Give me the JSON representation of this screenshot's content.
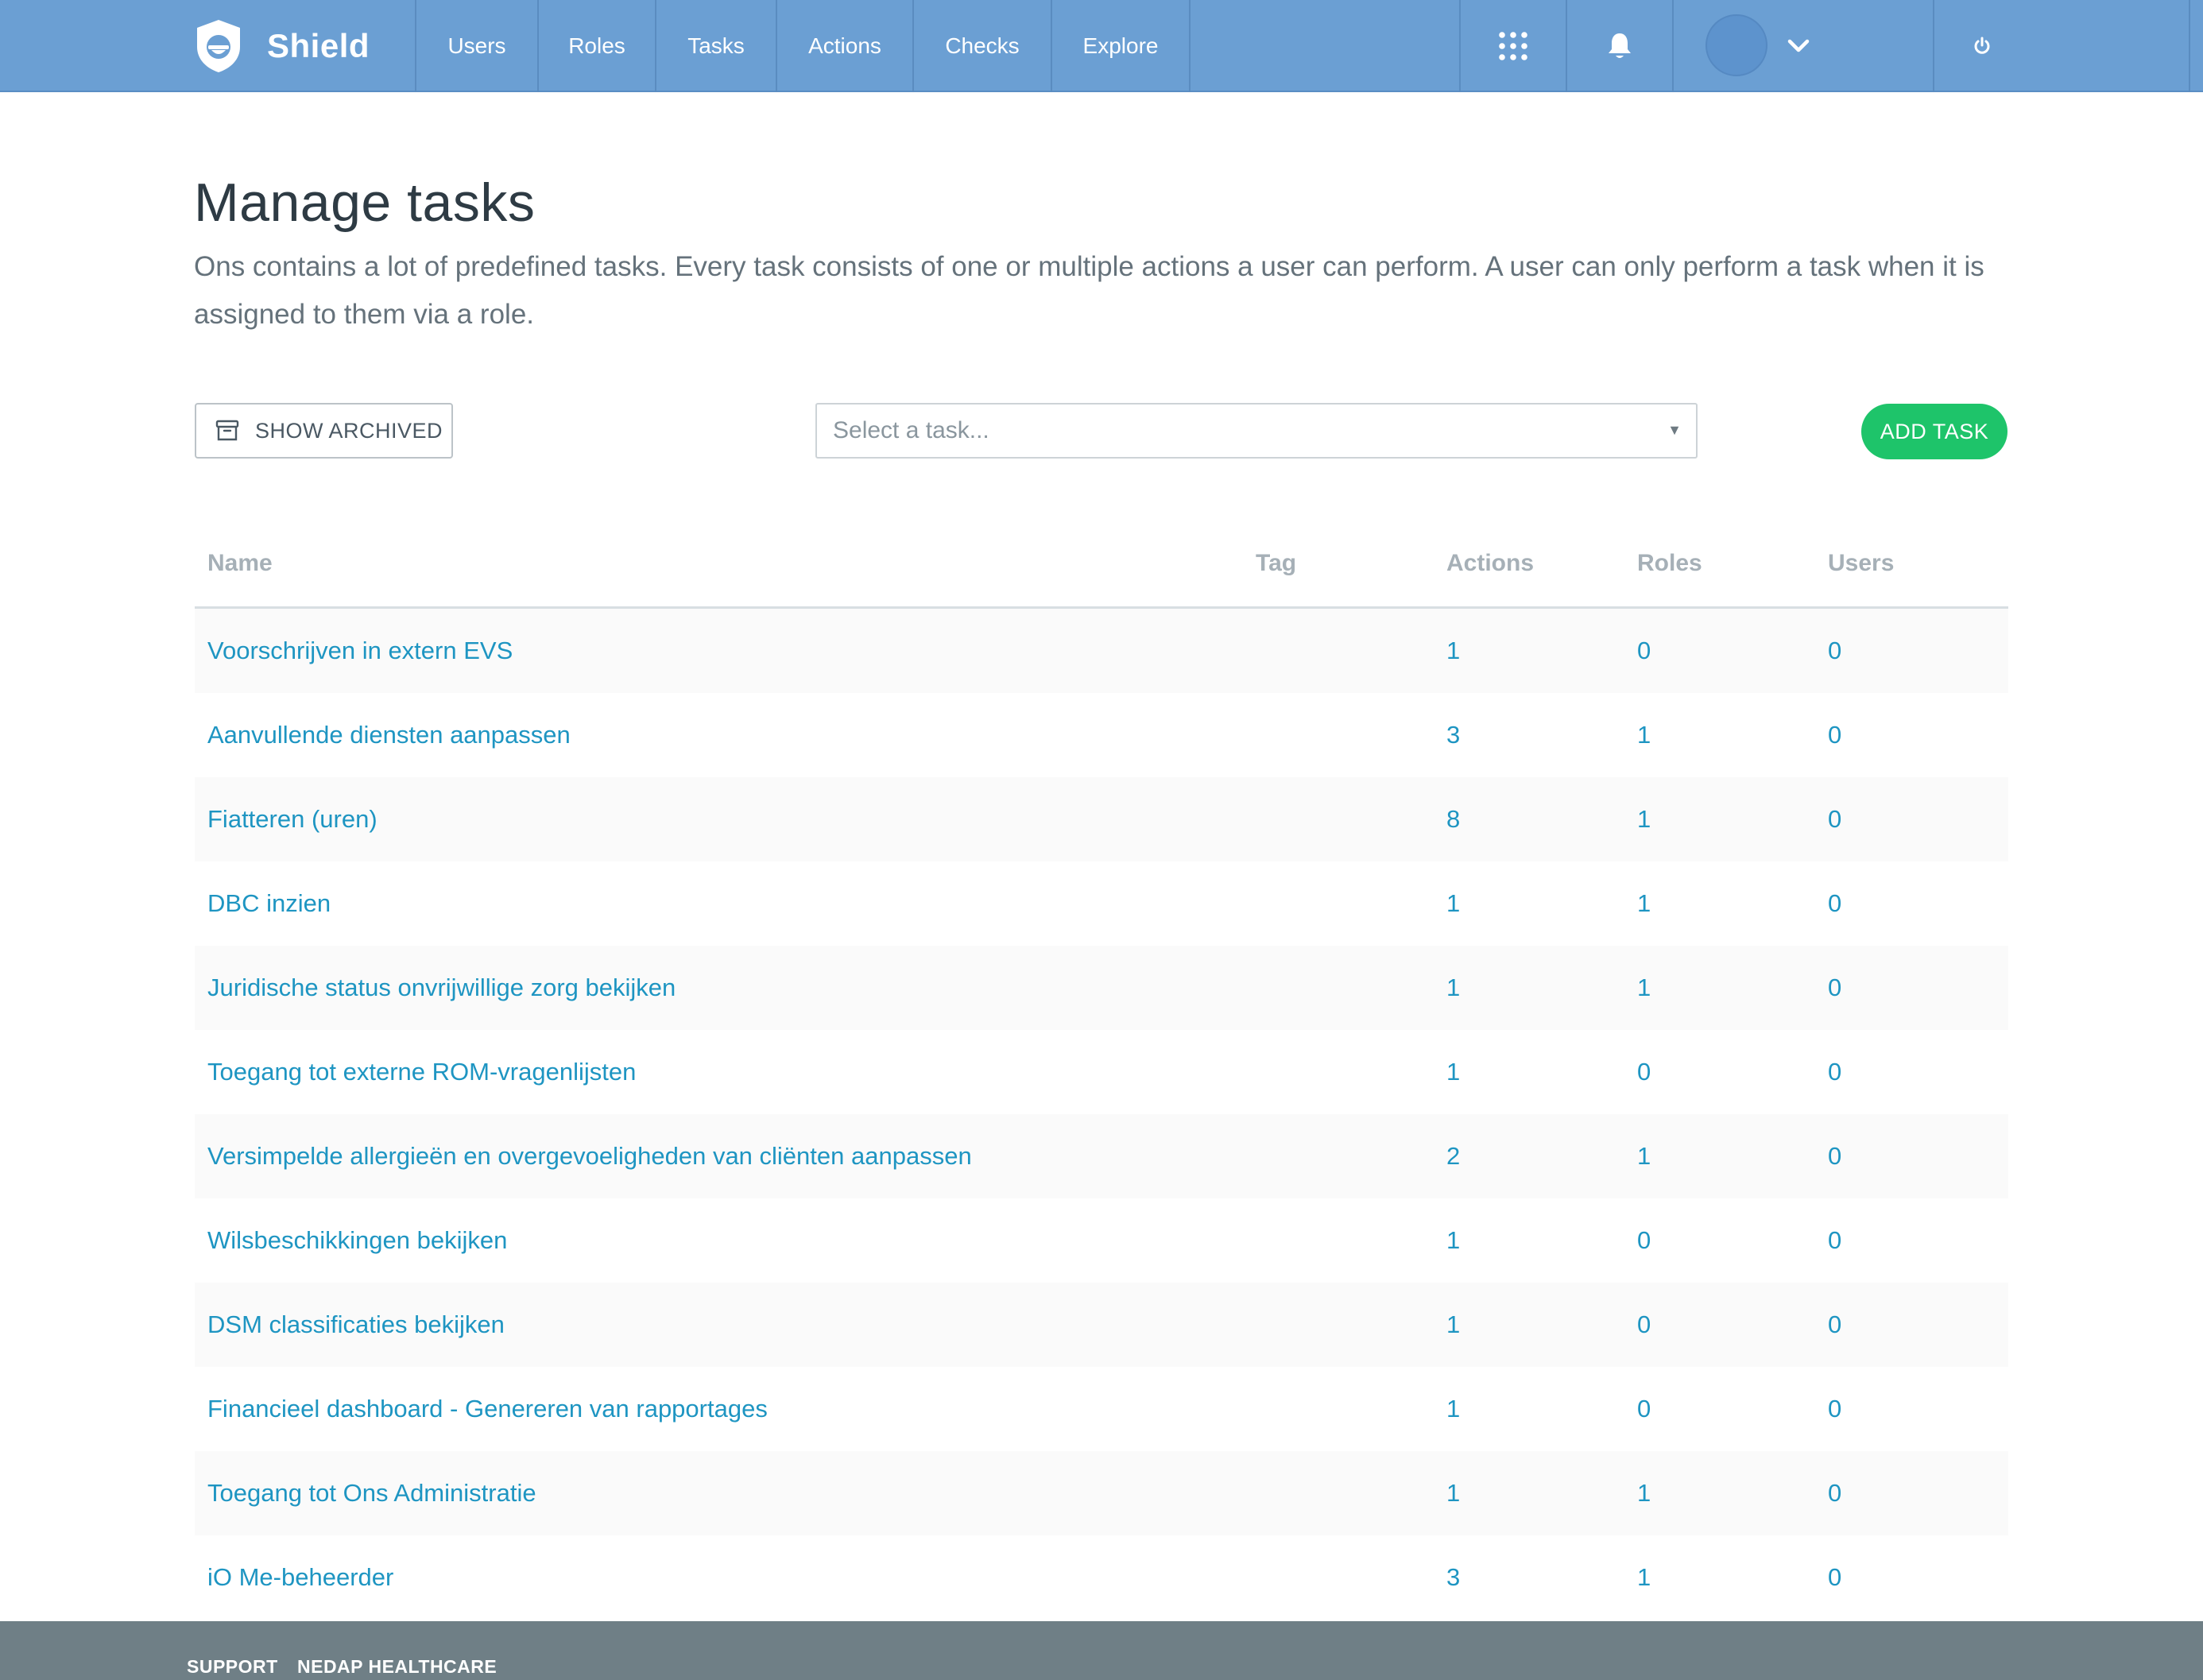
{
  "app": {
    "brand": "Shield",
    "nav": [
      {
        "label": "Users"
      },
      {
        "label": "Roles"
      },
      {
        "label": "Tasks"
      },
      {
        "label": "Actions"
      },
      {
        "label": "Checks"
      },
      {
        "label": "Explore"
      }
    ],
    "icons": {
      "apps": "grid-icon",
      "notifications": "bell-icon",
      "user_menu": "chevron-down-icon",
      "logout": "power-icon"
    },
    "colors": {
      "header_bg": "#6b9fd3",
      "link": "#1e95c2",
      "add_button": "#1ec46a",
      "footer_bg": "#6f7f86"
    }
  },
  "page": {
    "title": "Manage tasks",
    "intro": "Ons contains a lot of predefined tasks. Every task consists of one or multiple actions a user can perform. A user can only perform a task when it is assigned to them via a role."
  },
  "toolbar": {
    "show_archived_label": "SHOW ARCHIVED",
    "select_placeholder": "Select a task...",
    "add_task_label": "ADD TASK"
  },
  "table": {
    "headers": {
      "name": "Name",
      "tag": "Tag",
      "actions": "Actions",
      "roles": "Roles",
      "users": "Users"
    },
    "rows": [
      {
        "name": "Voorschrijven in extern EVS",
        "tag": "",
        "actions": "1",
        "roles": "0",
        "users": "0"
      },
      {
        "name": "Aanvullende diensten aanpassen",
        "tag": "",
        "actions": "3",
        "roles": "1",
        "users": "0"
      },
      {
        "name": "Fiatteren (uren)",
        "tag": "",
        "actions": "8",
        "roles": "1",
        "users": "0"
      },
      {
        "name": "DBC inzien",
        "tag": "",
        "actions": "1",
        "roles": "1",
        "users": "0"
      },
      {
        "name": "Juridische status onvrijwillige zorg bekijken",
        "tag": "",
        "actions": "1",
        "roles": "1",
        "users": "0"
      },
      {
        "name": "Toegang tot externe ROM-vragenlijsten",
        "tag": "",
        "actions": "1",
        "roles": "0",
        "users": "0"
      },
      {
        "name": "Versimpelde allergieën en overgevoeligheden van cliënten aanpassen",
        "tag": "",
        "actions": "2",
        "roles": "1",
        "users": "0"
      },
      {
        "name": "Wilsbeschikkingen bekijken",
        "tag": "",
        "actions": "1",
        "roles": "0",
        "users": "0"
      },
      {
        "name": "DSM classificaties bekijken",
        "tag": "",
        "actions": "1",
        "roles": "0",
        "users": "0"
      },
      {
        "name": "Financieel dashboard - Genereren van rapportages",
        "tag": "",
        "actions": "1",
        "roles": "0",
        "users": "0"
      },
      {
        "name": "Toegang tot Ons Administratie",
        "tag": "",
        "actions": "1",
        "roles": "1",
        "users": "0"
      },
      {
        "name": "iO Me-beheerder",
        "tag": "",
        "actions": "3",
        "roles": "1",
        "users": "0"
      }
    ]
  },
  "footer": {
    "links": [
      {
        "label": "SUPPORT"
      },
      {
        "label": "NEDAP HEALTHCARE"
      }
    ]
  }
}
